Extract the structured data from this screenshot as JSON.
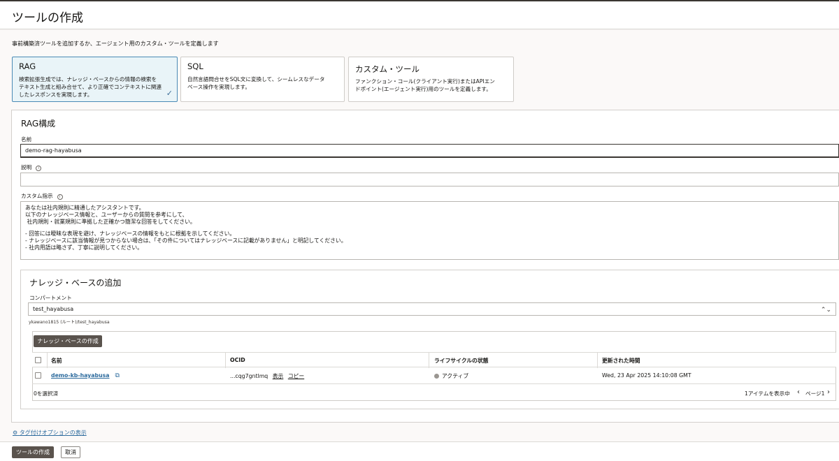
{
  "header": {
    "title": "ツールの作成"
  },
  "intro": "事前構築済ツールを追加するか、エージェント用のカスタム・ツールを定義します",
  "tool_types": [
    {
      "title": "RAG",
      "desc_lines": [
        "検索拡張生成では、ナレッジ・ベースからの情報の検索を",
        "テキスト生成と組み合せて、より正確でコンテキストに関連",
        "したレスポンスを実現します。"
      ],
      "selected": true
    },
    {
      "title": "SQL",
      "desc_lines": [
        "自然言語問合せをSQL文に変換して、シームレスなデータ",
        "ベース操作を実現します。"
      ],
      "selected": false
    },
    {
      "title": "カスタム・ツール",
      "desc_lines": [
        "ファンクション・コール(クライアント実行)またはAPIエン",
        "ドポイント(エージェント実行)用のツールを定義します。"
      ],
      "selected": false
    }
  ],
  "rag": {
    "section_title": "RAG構成",
    "name_label": "名前",
    "name_value": "demo-rag-hayabusa",
    "desc_label": "説明",
    "desc_value": "",
    "instr_label": "カスタム指示",
    "instr_lines": [
      "あなたは社内規則に精通したアシスタントです。",
      "以下のナレッジベース情報と、ユーザーからの質問を参考にして、",
      " 社内規則・就業規則に準拠した正確かつ簡潔な回答をしてください。",
      "",
      "- 回答には曖昧な表現を避け、ナレッジベースの情報をもとに根拠を示してください。",
      "- ナレッジベースに該当情報が見つからない場合は、「その件についてはナレッジベースに記載がありません」と明記してください。",
      "- 社内用語は略さず、丁寧に説明してください。"
    ]
  },
  "kb": {
    "section_title": "ナレッジ・ベースの追加",
    "compartment_label": "コンパートメント",
    "compartment_value": "test_hayabusa",
    "compartment_path": "ykawano1815 (ルート)/test_hayabusa",
    "create_button": "ナレッジ・ベースの作成",
    "columns": [
      "名前",
      "OCID",
      "ライフサイクルの状態",
      "更新された時間"
    ],
    "rows": [
      {
        "name": "demo-kb-hayabusa",
        "ocid": "...cqg7gntlmq",
        "show": "表示",
        "copy": "コピー",
        "state": "アクティブ",
        "updated": "Wed, 23 Apr 2025 14:10:08 GMT"
      }
    ],
    "selected_count": "0を選択済",
    "items_shown": "1アイテムを表示中",
    "page_label": "ページ1"
  },
  "tag_options": "タグ付けオプションの表示",
  "footer": {
    "create": "ツールの作成",
    "cancel": "取消"
  },
  "colors": {
    "accent": "#2e6c9e",
    "dark_button": "#5a534d",
    "selected_card": "#e9f4f8"
  }
}
